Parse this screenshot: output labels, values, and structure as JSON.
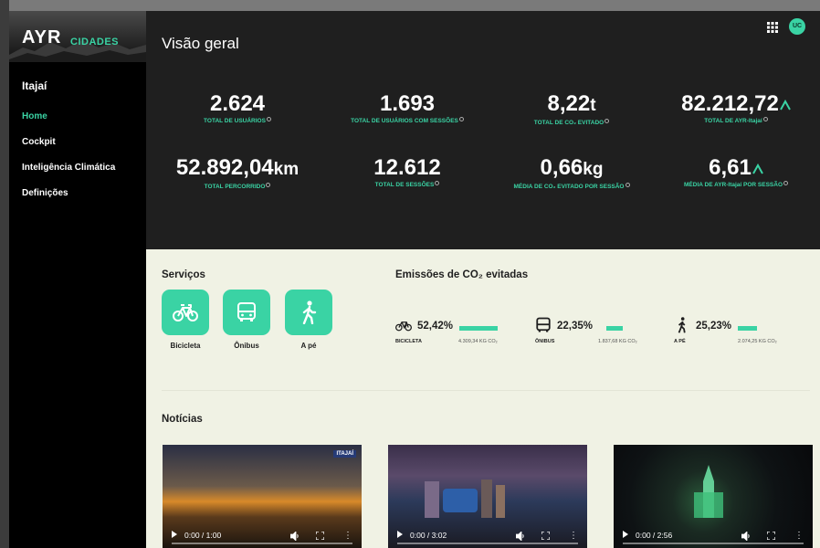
{
  "brand": {
    "name": "AYR",
    "product": "CIDADES"
  },
  "sidebar": {
    "city": "Itajaí",
    "items": [
      {
        "label": "Home",
        "active": true
      },
      {
        "label": "Cockpit",
        "active": false
      },
      {
        "label": "Inteligência Climática",
        "active": false
      },
      {
        "label": "Definições",
        "active": false
      }
    ]
  },
  "header": {
    "title": "Visão geral",
    "avatar_initials": "UC",
    "apps_icon": "grid-icon"
  },
  "stats": [
    {
      "value": "2.624",
      "unit": "",
      "label": "TOTAL DE USUÁRIOS"
    },
    {
      "value": "1.693",
      "unit": "",
      "label": "TOTAL DE USUÁRIOS COM SESSÕES"
    },
    {
      "value": "8,22",
      "unit": "t",
      "label": "TOTAL DE CO₂ EVITADO"
    },
    {
      "value": "82.212,72",
      "unit": "",
      "label": "TOTAL DE AYR-Itajaí"
    },
    {
      "value": "52.892,04",
      "unit": "km",
      "label": "TOTAL PERCORRIDO"
    },
    {
      "value": "12.612",
      "unit": "",
      "label": "TOTAL DE SESSÕES"
    },
    {
      "value": "0,66",
      "unit": "kg",
      "label": "MÉDIA DE CO₂ EVITADO POR SESSÃO"
    },
    {
      "value": "6,61",
      "unit": "",
      "label": "MÉDIA DE AYR-Itajaí POR SESSÃO"
    }
  ],
  "services": {
    "title": "Serviços",
    "items": [
      {
        "label": "Bicicleta",
        "icon": "bicycle-icon"
      },
      {
        "label": "Ônibus",
        "icon": "bus-icon"
      },
      {
        "label": "A pé",
        "icon": "walking-icon"
      }
    ]
  },
  "emissions": {
    "title": "Emissões de CO₂ evitadas",
    "items": [
      {
        "name": "BICICLETA",
        "percent": "52,42%",
        "share": 0.5242,
        "kg": "4.309,34 KG CO₂",
        "icon": "bicycle-icon"
      },
      {
        "name": "ÔNIBUS",
        "percent": "22,35%",
        "share": 0.2235,
        "kg": "1.837,68 KG CO₂",
        "icon": "bus-icon"
      },
      {
        "name": "A PÉ",
        "percent": "25,23%",
        "share": 0.2523,
        "kg": "2.074,25 KG CO₂",
        "icon": "walking-icon"
      }
    ]
  },
  "news": {
    "title": "Notícias",
    "videos": [
      {
        "time": "0:00 / 1:00",
        "badge": "ITAJAÍ"
      },
      {
        "time": "0:00 / 3:02",
        "badge": ""
      },
      {
        "time": "0:00 / 2:56",
        "badge": ""
      }
    ]
  },
  "colors": {
    "accent": "#3ad3a4",
    "dark": "#1f1f1f",
    "cream": "#f0f2e4",
    "sidebar": "#000000"
  }
}
